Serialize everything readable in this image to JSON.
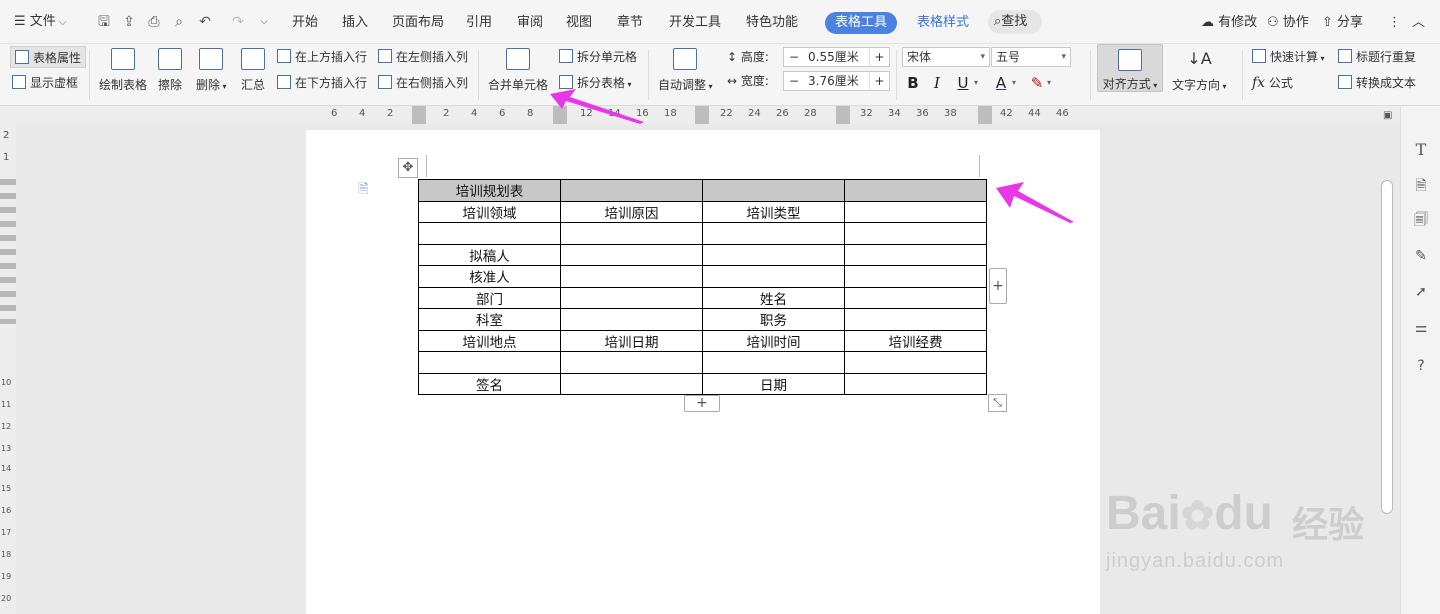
{
  "topbar": {
    "file_menu": "文件",
    "tabs": [
      "开始",
      "插入",
      "页面布局",
      "引用",
      "审阅",
      "视图",
      "章节",
      "开发工具",
      "特色功能"
    ],
    "active_tab": "表格工具",
    "style_tab": "表格样式",
    "search": "查找",
    "modified": "有修改",
    "collab": "协作",
    "share": "分享"
  },
  "ribbon": {
    "table_props": "表格属性",
    "show_grid": "显示虚框",
    "draw_table": "绘制表格",
    "erase": "擦除",
    "delete": "删除",
    "summary": "汇总",
    "insert_above": "在上方插入行",
    "insert_below": "在下方插入行",
    "insert_left": "在左侧插入列",
    "insert_right": "在右侧插入列",
    "merge_cells": "合并单元格",
    "split_cells": "拆分单元格",
    "split_table": "拆分表格",
    "auto_adjust": "自动调整",
    "height_label": "高度:",
    "height_value": "0.55厘米",
    "width_label": "宽度:",
    "width_value": "3.76厘米",
    "font_name": "宋体",
    "font_size": "五号",
    "bold": "B",
    "italic": "I",
    "underline": "U",
    "font_color": "A",
    "align": "对齐方式",
    "text_direction": "文字方向",
    "quick_calc": "快速计算",
    "formula": "公式",
    "repeat_header": "标题行重复",
    "to_text": "转换成文本"
  },
  "ruler": {
    "numbers": [
      "6",
      "4",
      "2",
      "2",
      "4",
      "6",
      "8",
      "12",
      "14",
      "16",
      "18",
      "22",
      "24",
      "26",
      "28",
      "32",
      "34",
      "36",
      "38",
      "42",
      "44",
      "46"
    ],
    "vnumbers": [
      "2",
      "1",
      "10",
      "11",
      "12",
      "13",
      "14",
      "15",
      "16",
      "17",
      "18",
      "19",
      "20"
    ]
  },
  "table": {
    "rows": [
      [
        "培训规划表",
        "",
        "",
        ""
      ],
      [
        "培训领域",
        "培训原因",
        "培训类型",
        ""
      ],
      [
        "",
        "",
        "",
        ""
      ],
      [
        "拟稿人",
        "",
        "",
        ""
      ],
      [
        "核准人",
        "",
        "",
        ""
      ],
      [
        "部门",
        "",
        "姓名",
        ""
      ],
      [
        "科室",
        "",
        "职务",
        ""
      ],
      [
        "培训地点",
        "培训日期",
        "培训时间",
        "培训经费"
      ],
      [
        "",
        "",
        "",
        ""
      ],
      [
        "签名",
        "",
        "日期",
        ""
      ]
    ]
  },
  "watermark": {
    "brand": "Bai",
    "brand2": "du",
    "cn": "经验",
    "url": "jingyan.baidu.com"
  },
  "colors": {
    "accent": "#4b82e0",
    "arrow": "#e838e6",
    "header_cell": "#c8c8c8"
  }
}
